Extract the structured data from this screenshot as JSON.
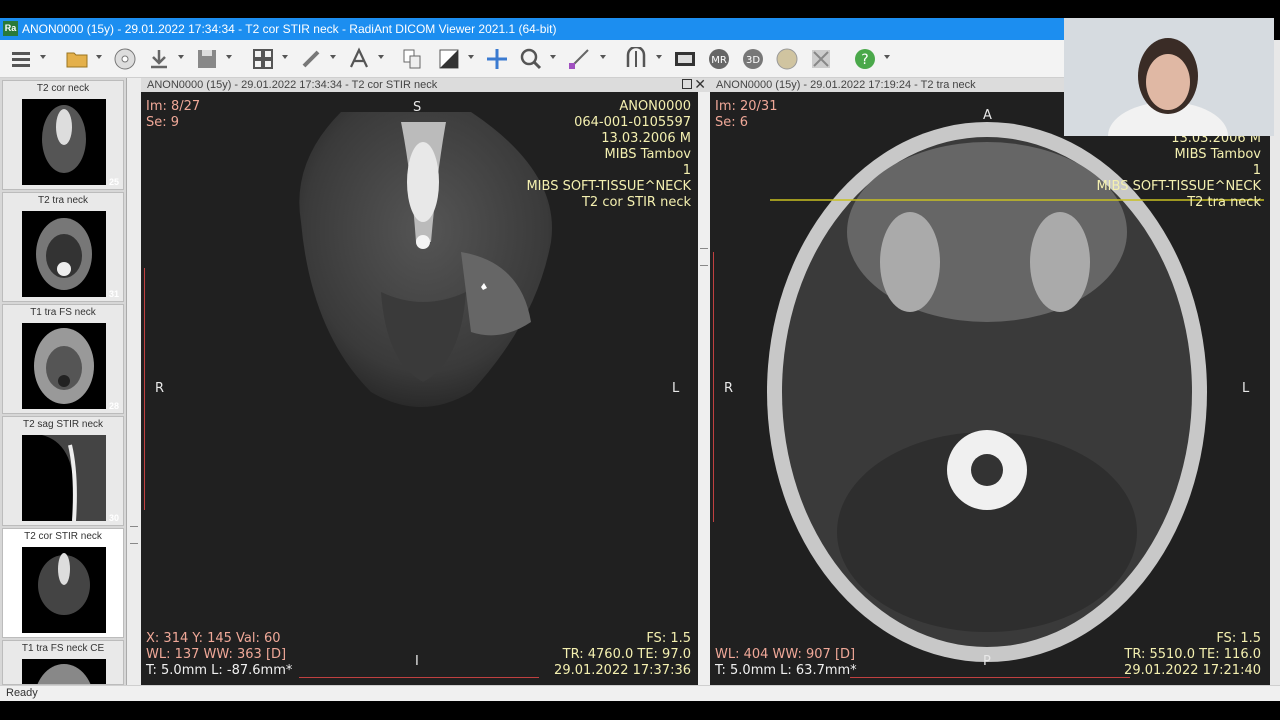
{
  "window": {
    "title": "ANON0000  (15y) - 29.01.2022 17:34:34 - T2 cor STIR neck - RadiAnt DICOM Viewer 2021.1 (64-bit)",
    "app_icon": "Ra"
  },
  "toolbar": {
    "icons": [
      "menu-icon",
      "open-folder-icon",
      "cd-icon",
      "download-icon",
      "save-icon",
      "layout-grid-icon",
      "link-icon",
      "text-icon",
      "compare-icon",
      "contrast-icon",
      "pan-icon",
      "zoom-icon",
      "measure-icon",
      "ruler-icon",
      "mpr-icon",
      "film-icon",
      "mr-icon",
      "3d-icon",
      "fusion-icon",
      "xray-icon",
      "help-icon"
    ]
  },
  "series": [
    {
      "label": "T2 cor neck",
      "count": "25",
      "image": "coronal"
    },
    {
      "label": "T2 tra neck",
      "count": "31",
      "image": "axial"
    },
    {
      "label": "T1 tra FS neck",
      "count": "28",
      "image": "axial-t1"
    },
    {
      "label": "T2 sag STIR neck",
      "count": "30",
      "image": "sagittal"
    },
    {
      "label": "T2 cor STIR neck",
      "count": "27",
      "image": "coronal-stir",
      "active": true
    },
    {
      "label": "T1 tra FS neck CE",
      "count": "",
      "image": "axial-t1"
    }
  ],
  "left_panel": {
    "header": "ANON0000  (15y) - 29.01.2022 17:34:34 - T2 cor STIR neck",
    "im": "Im: 8/27",
    "se": "Se: 9",
    "patient": [
      "ANON0000",
      "064-001-0105597",
      "13.03.2006 M",
      "MIBS Tambov",
      "1",
      "MIBS SOFT-TISSUE^NECK",
      "T2 cor STIR neck"
    ],
    "cursor": "X: 314 Y: 145 Val: 60",
    "window": "WL: 137 WW: 363 [D]",
    "thickness": "T: 5.0mm L: -87.6mm*",
    "fs": "FS: 1.5",
    "tr": "TR: 4760.0 TE: 97.0",
    "date": "29.01.2022 17:37:36",
    "orient": {
      "top": "S",
      "bottom": "I",
      "left": "R",
      "right": "L"
    }
  },
  "right_panel": {
    "header": "ANON0000  (15y) - 29.01.2022 17:19:24 - T2 tra neck",
    "im": "Im: 20/31",
    "se": "Se: 6",
    "patient": [
      "13.03.2006 M",
      "MIBS Tambov",
      "1",
      "MIBS SOFT-TISSUE^NECK",
      "T2 tra neck"
    ],
    "window": "WL: 404 WW: 907 [D]",
    "thickness": "T: 5.0mm L: 63.7mm*",
    "fs": "FS: 1.5",
    "tr": "TR: 5510.0 TE: 116.0",
    "date": "29.01.2022 17:21:40",
    "orient": {
      "top": "A",
      "bottom": "P",
      "left": "R",
      "right": "L"
    }
  },
  "status": "Ready",
  "colors": {
    "titlebar": "#1c8ef0",
    "overlay_left": "#f0a898",
    "overlay_right": "#f4f0b0",
    "reference_line": "#c8c020"
  }
}
